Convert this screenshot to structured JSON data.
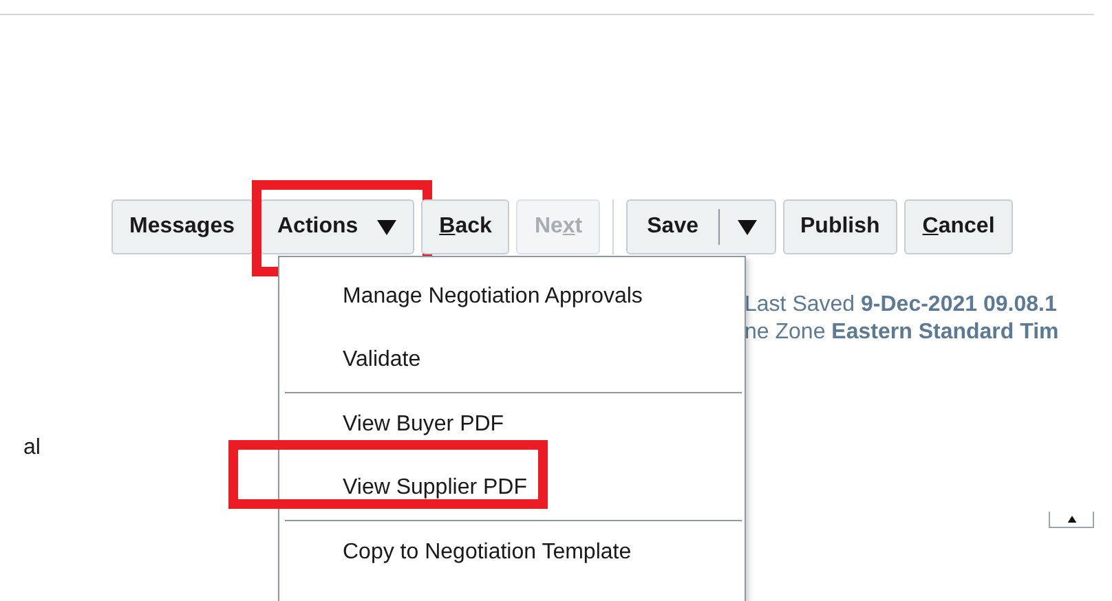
{
  "toolbar": {
    "buttons": [
      {
        "kind": "button",
        "label": [
          {
            "text": "Messages",
            "underlined": false
          }
        ],
        "disabled": false,
        "highlighted": false
      },
      {
        "kind": "menu",
        "label": [
          {
            "text": "Actions",
            "underlined": false
          }
        ],
        "disabled": false,
        "highlighted": true
      },
      {
        "kind": "button",
        "label": [
          {
            "text": "B",
            "underlined": true
          },
          {
            "text": "ack",
            "underlined": false
          }
        ],
        "disabled": false,
        "highlighted": false
      },
      {
        "kind": "button",
        "label": [
          {
            "text": "Ne",
            "underlined": false
          },
          {
            "text": "x",
            "underlined": true
          },
          {
            "text": "t",
            "underlined": false
          }
        ],
        "disabled": true,
        "highlighted": false
      },
      {
        "kind": "separator"
      },
      {
        "kind": "split",
        "label": [
          {
            "text": "Save",
            "underlined": false
          }
        ]
      },
      {
        "kind": "button",
        "label": [
          {
            "text": "Publish",
            "underlined": false
          }
        ],
        "disabled": false,
        "highlighted": false
      },
      {
        "kind": "button",
        "label": [
          {
            "text": "C",
            "underlined": true
          },
          {
            "text": "ancel",
            "underlined": false
          }
        ],
        "disabled": false,
        "highlighted": false
      }
    ]
  },
  "actions_menu": {
    "items": [
      {
        "kind": "item",
        "label": "Manage Negotiation Approvals",
        "highlighted": false
      },
      {
        "kind": "item",
        "label": "Validate",
        "highlighted": false
      },
      {
        "kind": "divider"
      },
      {
        "kind": "item",
        "label": "View Buyer PDF",
        "highlighted": false
      },
      {
        "kind": "item",
        "label": "View Supplier PDF",
        "highlighted": true
      },
      {
        "kind": "divider"
      },
      {
        "kind": "item",
        "label": "Copy to Negotiation Template",
        "highlighted": false
      }
    ]
  },
  "status": {
    "last_saved_label": "Last Saved",
    "last_saved_value": "9-Dec-2021 09.08.1",
    "timezone_label": "ne Zone",
    "timezone_value": "Eastern Standard Tim"
  },
  "side_label": "al"
}
